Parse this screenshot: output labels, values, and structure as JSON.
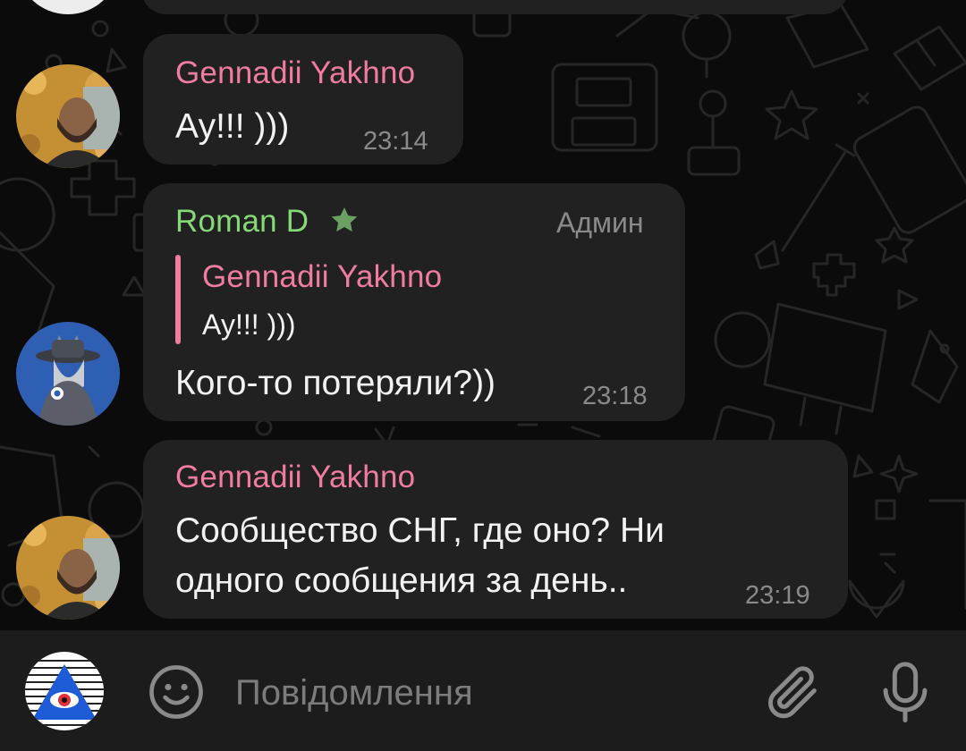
{
  "chat": {
    "messages": [
      {
        "sender": "Gennadii Yakhno",
        "text": "Ау!!! )))",
        "time": "23:14"
      },
      {
        "sender": "Roman D",
        "role": "Админ",
        "reply": {
          "sender": "Gennadii Yakhno",
          "text": "Ау!!! )))"
        },
        "text": "Кого-то потеряли?))",
        "time": "23:18"
      },
      {
        "sender": "Gennadii Yakhno",
        "lines": [
          "Сообщество СНГ, где оно? Ни",
          "одного сообщения за день.."
        ],
        "time": "23:19"
      }
    ]
  },
  "input": {
    "placeholder": "Повідомлення"
  },
  "icons": {
    "emoji": "smiley-icon",
    "attach": "paperclip-icon",
    "voice": "microphone-icon",
    "admin_badge": "star-icon",
    "send_as": "channel-avatar"
  },
  "colors": {
    "background": "#0b0b0b",
    "bubble": "#212121",
    "name_pink": "#f07ca0",
    "name_green": "#86d977",
    "reply_bar": "#f07ca0",
    "input_bar": "#1c1c1c"
  }
}
